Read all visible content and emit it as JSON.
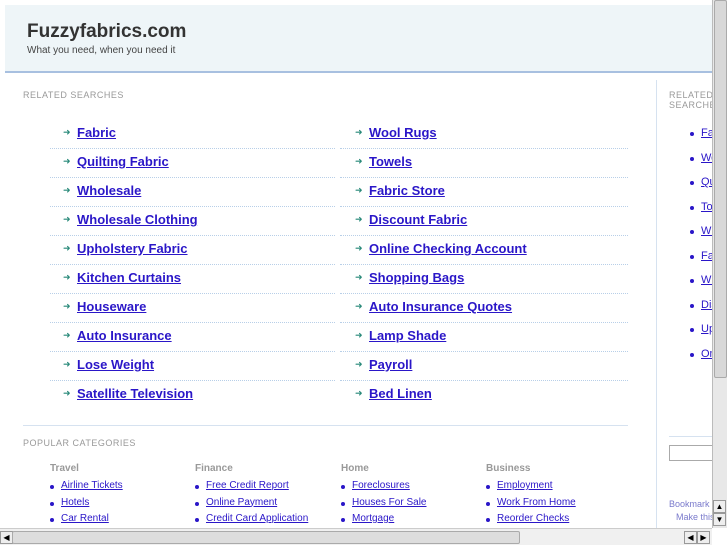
{
  "header": {
    "title": "Fuzzyfabrics.com",
    "tagline": "What you need, when you need it"
  },
  "related": {
    "label": "RELATED SEARCHES",
    "col1": [
      "Fabric",
      "Quilting Fabric",
      "Wholesale",
      "Wholesale Clothing",
      "Upholstery Fabric",
      "Kitchen Curtains",
      "Houseware",
      "Auto Insurance",
      "Lose Weight",
      "Satellite Television"
    ],
    "col2": [
      "Wool Rugs",
      "Towels",
      "Fabric Store",
      "Discount Fabric",
      "Online Checking Account",
      "Shopping Bags",
      "Auto Insurance Quotes",
      "Lamp Shade",
      "Payroll",
      "Bed Linen"
    ]
  },
  "popular": {
    "label": "POPULAR CATEGORIES",
    "categories": [
      {
        "name": "Travel",
        "items": [
          "Airline Tickets",
          "Hotels",
          "Car Rental"
        ]
      },
      {
        "name": "Finance",
        "items": [
          "Free Credit Report",
          "Online Payment",
          "Credit Card Application"
        ]
      },
      {
        "name": "Home",
        "items": [
          "Foreclosures",
          "Houses For Sale",
          "Mortgage"
        ]
      },
      {
        "name": "Business",
        "items": [
          "Employment",
          "Work From Home",
          "Reorder Checks"
        ]
      }
    ]
  },
  "sidebar": {
    "label": "RELATED SEARCHES",
    "items": [
      "Fabric",
      "Wool Rugs",
      "Quilting Fabric",
      "Towels",
      "Wholesale",
      "Fabric Store",
      "Wholesale Clothing",
      "Discount Fabric",
      "Upholstery Fabric",
      "Online Checking Account"
    ],
    "bookmark": "Bookmark this page",
    "make": "Make this your homepage"
  }
}
